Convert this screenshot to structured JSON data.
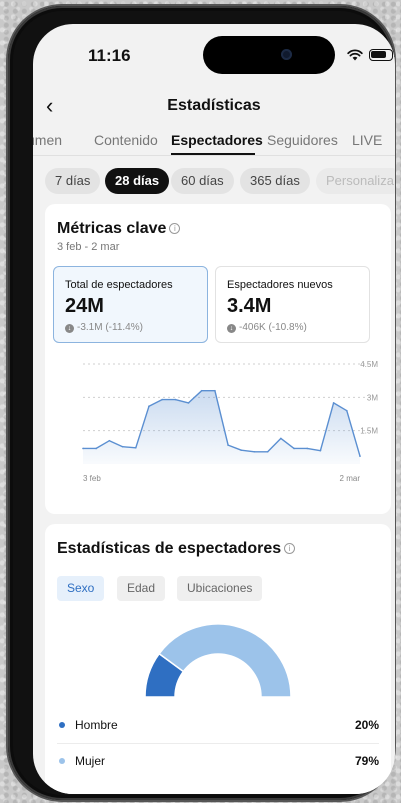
{
  "status_bar": {
    "time": "11:16"
  },
  "header": {
    "title": "Estadísticas"
  },
  "tabs": [
    {
      "label": "umen"
    },
    {
      "label": "Contenido"
    },
    {
      "label": "Espectadores",
      "active": true
    },
    {
      "label": "Seguidores"
    },
    {
      "label": "LIVE"
    }
  ],
  "ranges": [
    {
      "label": "7 días"
    },
    {
      "label": "28 días",
      "active": true
    },
    {
      "label": "60 días"
    },
    {
      "label": "365 días"
    },
    {
      "label": "Personaliza"
    }
  ],
  "key_metrics": {
    "title": "Métricas clave",
    "date_range": "3 feb - 2 mar",
    "cards": [
      {
        "label": "Total de espectadores",
        "value": "24M",
        "change": "-3.1M (-11.4%)",
        "active": true
      },
      {
        "label": "Espectadores nuevos",
        "value": "3.4M",
        "change": "-406K (-10.8%)",
        "active": false
      }
    ]
  },
  "chart_data": {
    "type": "area",
    "x_start_label": "3 feb",
    "x_end_label": "2 mar",
    "yticks": [
      "4.5M",
      "3M",
      "1.5M"
    ],
    "ytick_values": [
      4500000,
      3000000,
      1500000
    ],
    "ylim": [
      0,
      4500000
    ],
    "values": [
      700000,
      700000,
      1050000,
      780000,
      730000,
      2600000,
      2900000,
      2900000,
      2750000,
      3300000,
      3300000,
      850000,
      620000,
      550000,
      550000,
      1150000,
      700000,
      700000,
      600000,
      2750000,
      2400000,
      350000
    ],
    "color": "#5b8fd1"
  },
  "viewer_stats": {
    "title": "Estadísticas de espectadores",
    "filters": [
      {
        "label": "Sexo",
        "active": true
      },
      {
        "label": "Edad"
      },
      {
        "label": "Ubicaciones"
      }
    ],
    "gender": [
      {
        "label": "Hombre",
        "percent": "20%",
        "value": 20,
        "color": "#2f6fc2"
      },
      {
        "label": "Mujer",
        "percent": "79%",
        "value": 79,
        "color": "#9cc3ea"
      }
    ]
  }
}
